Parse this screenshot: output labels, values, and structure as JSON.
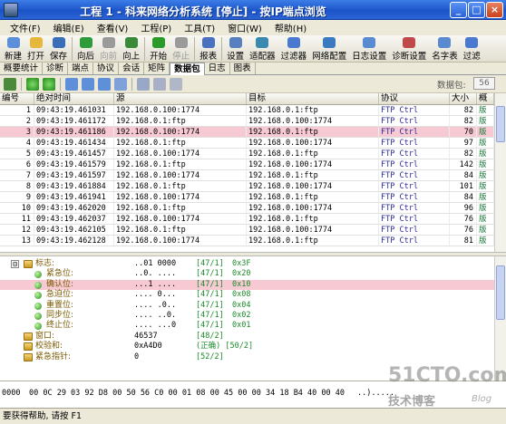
{
  "window": {
    "title": "工程 1 - 科来网络分析系统 [停止] - 按IP端点浏览",
    "minimize": "_",
    "maximize": "□",
    "close": "×"
  },
  "menu": [
    "文件(F)",
    "编辑(E)",
    "查看(V)",
    "工程(P)",
    "工具(T)",
    "窗口(W)",
    "帮助(H)"
  ],
  "toolbar": [
    {
      "label": "新建",
      "icon": "new-icon",
      "color": "#5b8fd9"
    },
    {
      "label": "打开",
      "icon": "open-icon",
      "color": "#e6b73a"
    },
    {
      "label": "保存",
      "icon": "save-icon",
      "color": "#3a6fb8"
    },
    {
      "label": "向后",
      "icon": "back-icon",
      "color": "#2e9b3a"
    },
    {
      "label": "向前",
      "icon": "forward-icon",
      "color": "#9a9a9a",
      "disabled": true
    },
    {
      "label": "向上",
      "icon": "up-icon",
      "color": "#3a8a3a"
    },
    {
      "label": "开始",
      "icon": "start-icon",
      "color": "#2a9a2a"
    },
    {
      "label": "停止",
      "icon": "stop-icon",
      "color": "#9a9a9a",
      "disabled": true
    },
    {
      "label": "报表",
      "icon": "report-icon",
      "color": "#4a70c0"
    },
    {
      "label": "设置",
      "icon": "settings-icon",
      "color": "#5a7fc0"
    },
    {
      "label": "适配器",
      "icon": "adapter-icon",
      "color": "#3a8ab0"
    },
    {
      "label": "过滤器",
      "icon": "filter-icon",
      "color": "#4a7ad0"
    },
    {
      "label": "网络配置",
      "icon": "network-config-icon",
      "color": "#3a7ac0"
    },
    {
      "label": "日志设置",
      "icon": "log-settings-icon",
      "color": "#5a8ad0"
    },
    {
      "label": "诊断设置",
      "icon": "diagnosis-settings-icon",
      "color": "#c04a4a"
    },
    {
      "label": "名字表",
      "icon": "name-table-icon",
      "color": "#5a8ad0"
    },
    {
      "label": "过滤",
      "icon": "filter2-icon",
      "color": "#4a7ad0"
    }
  ],
  "tabs": [
    "概要统计",
    "诊断",
    "端点",
    "协议",
    "会话",
    "矩阵",
    "数据包",
    "日志",
    "图表"
  ],
  "active_tab": "数据包",
  "subtoolbar": {
    "packet_count_label": "数据包:",
    "packet_count": "56"
  },
  "grid": {
    "columns": [
      "编号",
      "绝对时间",
      "源",
      "目标",
      "协议",
      "大小",
      "概"
    ],
    "rows": [
      {
        "no": "1",
        "time": "09:43:19.461031",
        "src": "192.168.0.100:1774",
        "dst": "192.168.0.1:ftp",
        "proto": "FTP Ctrl",
        "size": "82",
        "sum": "版"
      },
      {
        "no": "2",
        "time": "09:43:19.461172",
        "src": "192.168.0.1:ftp",
        "dst": "192.168.0.100:1774",
        "proto": "FTP Ctrl",
        "size": "82",
        "sum": "版"
      },
      {
        "no": "3",
        "time": "09:43:19.461186",
        "src": "192.168.0.100:1774",
        "dst": "192.168.0.1:ftp",
        "proto": "FTP Ctrl",
        "size": "70",
        "sum": "版"
      },
      {
        "no": "4",
        "time": "09:43:19.461434",
        "src": "192.168.0.1:ftp",
        "dst": "192.168.0.100:1774",
        "proto": "FTP Ctrl",
        "size": "97",
        "sum": "版"
      },
      {
        "no": "5",
        "time": "09:43:19.461457",
        "src": "192.168.0.100:1774",
        "dst": "192.168.0.1:ftp",
        "proto": "FTP Ctrl",
        "size": "82",
        "sum": "版"
      },
      {
        "no": "6",
        "time": "09:43:19.461579",
        "src": "192.168.0.1:ftp",
        "dst": "192.168.0.100:1774",
        "proto": "FTP Ctrl",
        "size": "142",
        "sum": "版"
      },
      {
        "no": "7",
        "time": "09:43:19.461597",
        "src": "192.168.0.100:1774",
        "dst": "192.168.0.1:ftp",
        "proto": "FTP Ctrl",
        "size": "84",
        "sum": "版"
      },
      {
        "no": "8",
        "time": "09:43:19.461884",
        "src": "192.168.0.1:ftp",
        "dst": "192.168.0.100:1774",
        "proto": "FTP Ctrl",
        "size": "101",
        "sum": "版"
      },
      {
        "no": "9",
        "time": "09:43:19.461941",
        "src": "192.168.0.100:1774",
        "dst": "192.168.0.1:ftp",
        "proto": "FTP Ctrl",
        "size": "84",
        "sum": "版"
      },
      {
        "no": "10",
        "time": "09:43:19.462020",
        "src": "192.168.0.1:ftp",
        "dst": "192.168.0.100:1774",
        "proto": "FTP Ctrl",
        "size": "96",
        "sum": "版"
      },
      {
        "no": "11",
        "time": "09:43:19.462037",
        "src": "192.168.0.100:1774",
        "dst": "192.168.0.1:ftp",
        "proto": "FTP Ctrl",
        "size": "76",
        "sum": "版"
      },
      {
        "no": "12",
        "time": "09:43:19.462105",
        "src": "192.168.0.1:ftp",
        "dst": "192.168.0.100:1774",
        "proto": "FTP Ctrl",
        "size": "76",
        "sum": "版"
      },
      {
        "no": "13",
        "time": "09:43:19.462128",
        "src": "192.168.0.100:1774",
        "dst": "192.168.0.1:ftp",
        "proto": "FTP Ctrl",
        "size": "81",
        "sum": "版"
      }
    ],
    "selected_row": "3"
  },
  "detail": [
    {
      "level": 2,
      "type": "folder",
      "name": "标志:",
      "val": "..01 0000",
      "pos": "[47/1]",
      "hex": "0x3F",
      "expand": "⊟"
    },
    {
      "level": 3,
      "type": "dot",
      "name": "紧急位:",
      "val": "..0. ....",
      "pos": "[47/1]",
      "hex": "0x20"
    },
    {
      "level": 3,
      "type": "dot",
      "name": "确认位:",
      "val": "...1 ....",
      "pos": "[47/1]",
      "hex": "0x10",
      "selected": true
    },
    {
      "level": 3,
      "type": "dot",
      "name": "急迫位:",
      "val": ".... 0...",
      "pos": "[47/1]",
      "hex": "0x08"
    },
    {
      "level": 3,
      "type": "dot",
      "name": "重置位:",
      "val": ".... .0..",
      "pos": "[47/1]",
      "hex": "0x04"
    },
    {
      "level": 3,
      "type": "dot",
      "name": "同步位:",
      "val": ".... ..0.",
      "pos": "[47/1]",
      "hex": "0x02"
    },
    {
      "level": 3,
      "type": "dot",
      "name": "终止位:",
      "val": ".... ...0",
      "pos": "[47/1]",
      "hex": "0x01"
    },
    {
      "level": 2,
      "type": "folder",
      "name": "窗口:",
      "val": "46537",
      "pos": "[48/2]",
      "hex": ""
    },
    {
      "level": 2,
      "type": "folder",
      "name": "校验和:",
      "val": "0xA4D0",
      "pos": "(正确)  [50/2]",
      "hex": ""
    },
    {
      "level": 2,
      "type": "folder",
      "name": "紧急指针:",
      "val": "0",
      "pos": "[52/2]",
      "hex": ""
    }
  ],
  "hex": {
    "offset": "0000",
    "bytes": "00 0C 29 03 92 D8 00 50 56 C0 00 01 08 00 45 00 00 34 18 B4 40 00 40",
    "ascii": "..)....."
  },
  "status": "要获得帮助, 请按 F1",
  "watermark": {
    "main": "51CTO.com",
    "sub": "技术博客",
    "blog": "Blog"
  }
}
